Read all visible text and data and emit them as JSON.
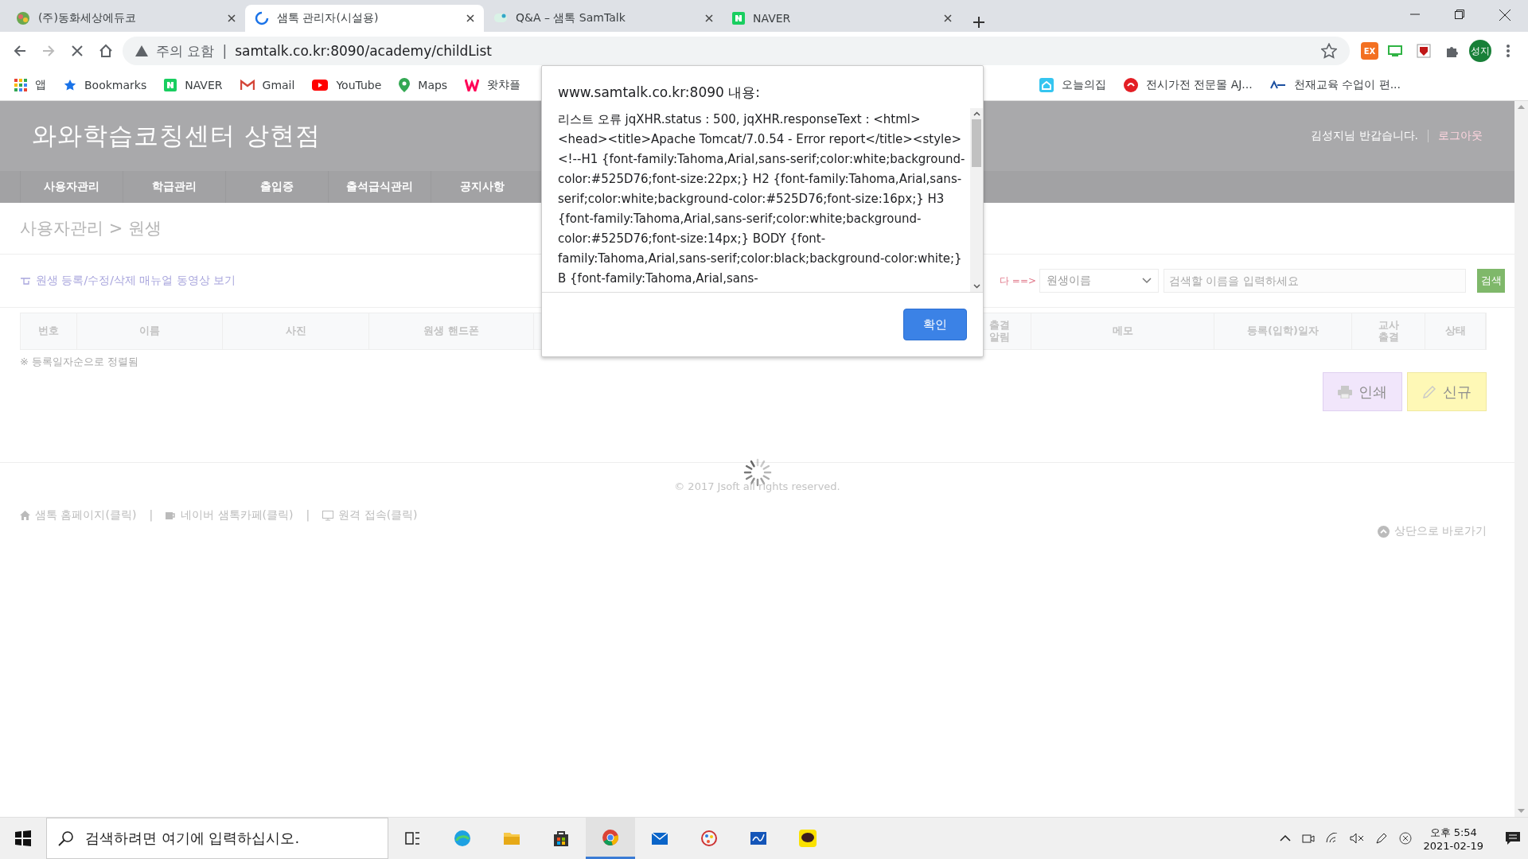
{
  "browser": {
    "tabs": [
      {
        "title": "(주)동화세상에듀코",
        "selected": false
      },
      {
        "title": "샘톡 관리자(시설용)",
        "selected": true
      },
      {
        "title": "Q&A – 샘톡 SamTalk",
        "selected": false
      },
      {
        "title": "NAVER",
        "selected": false
      }
    ],
    "address": {
      "warning": "주의 요함",
      "separator": "|",
      "url": "samtalk.co.kr:8090/academy/childList"
    },
    "extension_label": "EX",
    "profile": "성지",
    "bookmarks": [
      {
        "label": "앱"
      },
      {
        "label": "Bookmarks"
      },
      {
        "label": "NAVER"
      },
      {
        "label": "Gmail"
      },
      {
        "label": "YouTube"
      },
      {
        "label": "Maps"
      },
      {
        "label": "왓챠플"
      }
    ],
    "bookmarks_right": [
      {
        "label": "오늘의집"
      },
      {
        "label": "전시가전 전문몰 AJ..."
      },
      {
        "label": "천재교육 수업이 편..."
      }
    ]
  },
  "page": {
    "site_title": "와와학습코칭센터 상현점",
    "greeting": "김성지님 반갑습니다.",
    "logout": "로그아웃",
    "nav": [
      {
        "label": "사용자관리"
      },
      {
        "label": "학급관리"
      },
      {
        "label": "출입증"
      },
      {
        "label": "출석급식관리"
      },
      {
        "label": "공지사항"
      }
    ],
    "breadcrumb": "사용자관리 > 원생",
    "manual_link": "원생 등록/수정/삭제 매뉴얼 동영상 보기",
    "search": {
      "hint": "다 ==>",
      "filter": "원생이름",
      "placeholder": "검색할 이름을 입력하세요",
      "button": "검색"
    },
    "table": {
      "columns": [
        "번호",
        "이름",
        "사진",
        "원생 핸드폰",
        "출결\n알림",
        "메모",
        "등록(입학)일자",
        "교사\n출결",
        "상태"
      ]
    },
    "note": "※ 등록일자순으로 정렬됨",
    "buttons": [
      {
        "label": "인쇄",
        "kind": "print"
      },
      {
        "label": "신규",
        "kind": "new"
      }
    ],
    "copyright": "© 2017 Jsoft all rights reserved.",
    "footer_links": [
      {
        "label": "샘톡 홈페이지(클릭)"
      },
      {
        "label": "네이버 샘톡카페(클릭)"
      },
      {
        "label": "원격 접속(클릭)"
      }
    ],
    "footer_separator": "|",
    "top_link": "상단으로 바로가기"
  },
  "dialog": {
    "title": "www.samtalk.co.kr:8090 내용:",
    "message": "리스트 오류   jqXHR.status : 500, jqXHR.responseText : <html><head><title>Apache Tomcat/7.0.54 - Error report</title><style><!--H1 {font-family:Tahoma,Arial,sans-serif;color:white;background-color:#525D76;font-size:22px;} H2 {font-family:Tahoma,Arial,sans-serif;color:white;background-color:#525D76;font-size:16px;} H3 {font-family:Tahoma,Arial,sans-serif;color:white;background-color:#525D76;font-size:14px;} BODY {font-family:Tahoma,Arial,sans-serif;color:black;background-color:white;} B {font-family:Tahoma,Arial,sans-",
    "ok": "확인"
  },
  "taskbar": {
    "search_placeholder": "검색하려면 여기에 입력하십시오.",
    "apps": [
      {
        "selected": false
      },
      {
        "selected": false
      },
      {
        "selected": false
      },
      {
        "selected": false
      },
      {
        "selected": true
      },
      {
        "selected": false
      },
      {
        "selected": false
      },
      {
        "selected": false
      },
      {
        "selected": false
      }
    ],
    "time": "오후 5:54",
    "date": "2021-02-19"
  }
}
